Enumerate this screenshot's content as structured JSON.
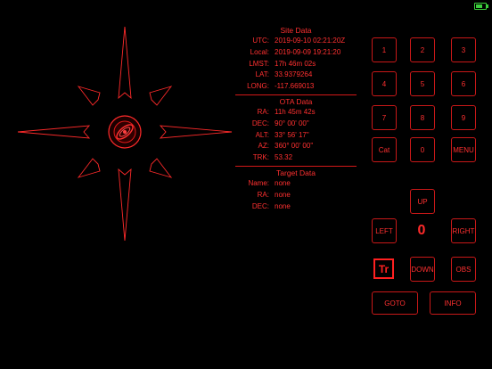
{
  "status": {
    "battery_level": 0.7,
    "battery_color": "#3ccf3c"
  },
  "theme": {
    "accent": "#ff2a2a",
    "border": "#c81818",
    "background": "#000000"
  },
  "site": {
    "title": "Site Data",
    "rows": [
      {
        "label": "UTC:",
        "value": "2019-09-10 02:21:20Z"
      },
      {
        "label": "Local:",
        "value": "2019-09-09 19:21:20"
      },
      {
        "label": "LMST:",
        "value": "17h 46m 02s"
      },
      {
        "label": "LAT:",
        "value": "33.9379264"
      },
      {
        "label": "LONG:",
        "value": "-117.669013"
      }
    ]
  },
  "ota": {
    "title": "OTA Data",
    "rows": [
      {
        "label": "RA:",
        "value": "11h 45m 42s"
      },
      {
        "label": "DEC:",
        "value": "90° 00' 00\""
      },
      {
        "label": "ALT:",
        "value": "33° 56' 17\""
      },
      {
        "label": "AZ:",
        "value": "360° 00' 00\""
      },
      {
        "label": "TRK:",
        "value": "53.32"
      }
    ]
  },
  "target": {
    "title": "Target Data",
    "rows": [
      {
        "label": "Name:",
        "value": "none"
      },
      {
        "label": "RA:",
        "value": "none"
      },
      {
        "label": "DEC:",
        "value": "none"
      }
    ]
  },
  "keypad": {
    "k1": "1",
    "k2": "2",
    "k3": "3",
    "k4": "4",
    "k5": "5",
    "k6": "6",
    "k7": "7",
    "k8": "8",
    "k9": "9",
    "cat": "Cat",
    "k0": "0",
    "menu": "MENU"
  },
  "motion": {
    "up": "UP",
    "left": "LEFT",
    "right": "RIGHT",
    "down": "DOWN",
    "obs": "OBS",
    "speed": "0",
    "tracking": "Tr"
  },
  "actions": {
    "goto": "GOTO",
    "info": "INFO"
  }
}
